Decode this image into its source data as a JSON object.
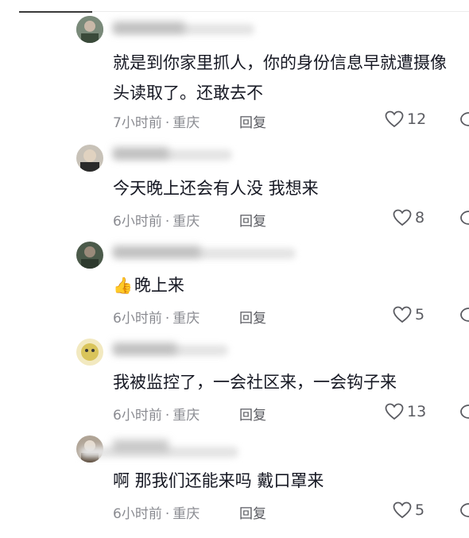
{
  "comments": [
    {
      "username": "▒▒▒▒▒▒▒▒▒",
      "text": "就是到你家里抓人，你的身份信息早就遭摄像头读取了。还敢去不",
      "time": "7小时前",
      "location": "重庆",
      "reply_label": "回复",
      "likes": "12",
      "avatar_color": "#6a7a6a"
    },
    {
      "username": "▒▒▒▒▒▒▒",
      "text": "今天晚上还会有人没 我想来",
      "time": "6小时前",
      "location": "重庆",
      "reply_label": "回复",
      "likes": "8",
      "avatar_color": "#b8b0a4"
    },
    {
      "username": "▒▒▒▒▒▒▒▒▒▒▒",
      "emoji": "👍",
      "text": "晚上来",
      "time": "6小时前",
      "location": "重庆",
      "reply_label": "回复",
      "likes": "5",
      "avatar_color": "#4b5a4a"
    },
    {
      "username": "▒▒▒▒▒▒▒▒",
      "text": "我被监控了，一会社区来，一会钩子来",
      "time": "6小时前",
      "location": "重庆",
      "reply_label": "回复",
      "likes": "13",
      "avatar_color": "#d9c45a"
    },
    {
      "username": "▒▒▒▒▒▒▒",
      "text": "啊 那我们还能来吗 戴口罩来",
      "time": "6小时前",
      "location": "重庆",
      "reply_label": "回复",
      "likes": "5",
      "avatar_color": "#8a7a6a"
    }
  ]
}
